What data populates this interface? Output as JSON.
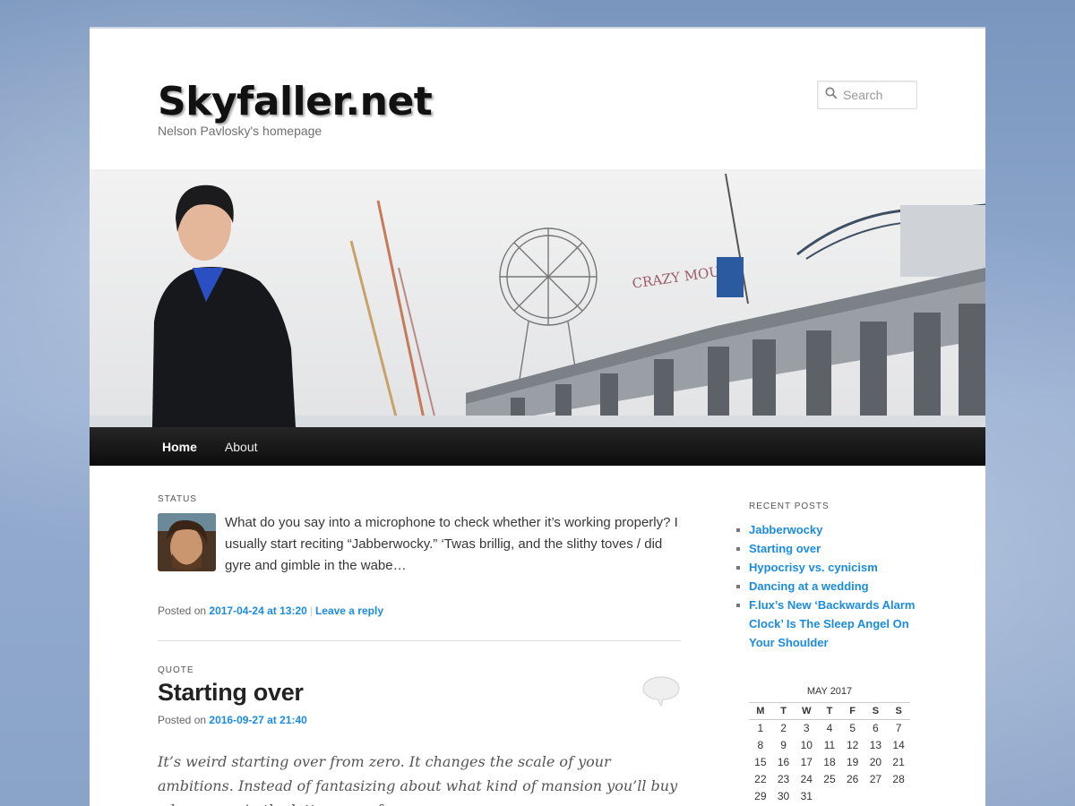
{
  "site": {
    "title": "Skyfaller.net",
    "description": "Nelson Pavlosky's homepage"
  },
  "search": {
    "placeholder": "Search"
  },
  "nav": {
    "items": [
      {
        "label": "Home"
      },
      {
        "label": "About"
      }
    ]
  },
  "posts": [
    {
      "format": "STATUS",
      "text": "What do you say into a microphone to check whether it’s working properly? I usually start reciting “Jabberwocky.” ‘Twas brillig, and the slithy toves / did gyre and gimble in the wabe…",
      "posted_prefix": "Posted on",
      "date": "2017-04-24 at 13:20",
      "reply": "Leave a reply"
    },
    {
      "format": "QUOTE",
      "title": "Starting over",
      "posted_prefix": "Posted on",
      "date": "2016-09-27 at 21:40",
      "text": "It’s weird starting over from zero. It changes the scale of your ambitions. Instead of fantasizing about what kind of mansion you’ll buy when you win the lottery, you focus on…"
    }
  ],
  "sidebar": {
    "recent_title": "RECENT POSTS",
    "recent_posts": [
      "Jabberwocky",
      "Starting over",
      "Hypocrisy vs. cynicism",
      "Dancing at a wedding",
      "F.lux’s New ‘Backwards Alarm Clock’ Is The Sleep Angel On Your Shoulder"
    ],
    "calendar": {
      "caption": "MAY 2017",
      "days": [
        "M",
        "T",
        "W",
        "T",
        "F",
        "S",
        "S"
      ],
      "weeks": [
        [
          "1",
          "2",
          "3",
          "4",
          "5",
          "6",
          "7"
        ],
        [
          "8",
          "9",
          "10",
          "11",
          "12",
          "13",
          "14"
        ],
        [
          "15",
          "16",
          "17",
          "18",
          "19",
          "20",
          "21"
        ],
        [
          "22",
          "23",
          "24",
          "25",
          "26",
          "27",
          "28"
        ],
        [
          "29",
          "30",
          "31",
          "",
          "",
          "",
          ""
        ]
      ]
    }
  },
  "icons": {
    "search": "search-icon",
    "comment": "comment-bubble-icon"
  },
  "colors": {
    "link": "#1b8be0",
    "nav_bg": "#111111",
    "background": "#7e98bd"
  }
}
